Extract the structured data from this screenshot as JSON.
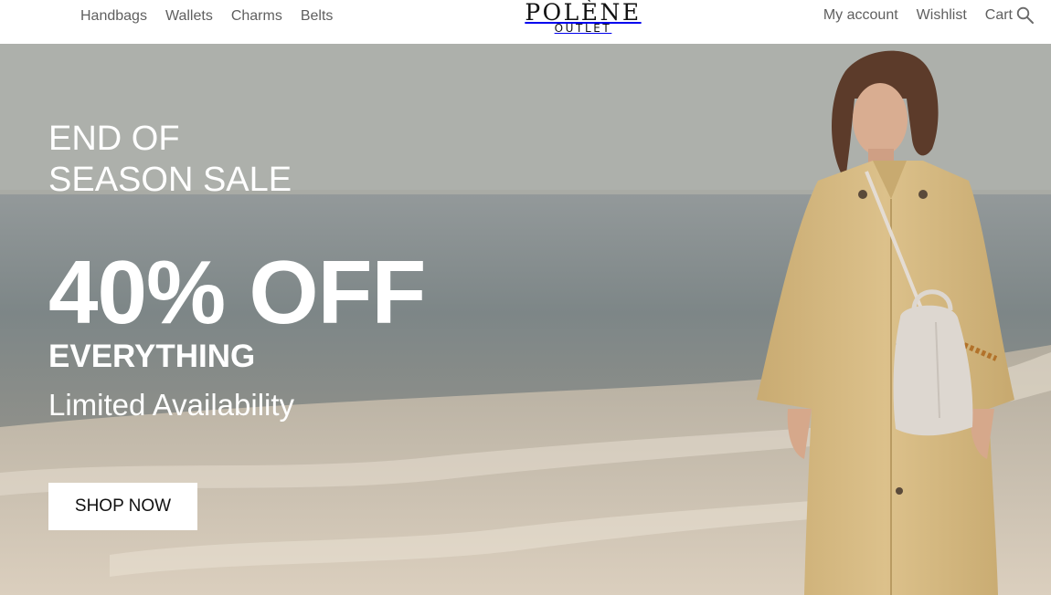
{
  "header": {
    "nav_left": [
      "Handbags",
      "Wallets",
      "Charms",
      "Belts"
    ],
    "logo": {
      "word": "POLÈNE",
      "sub": "OUTLET"
    },
    "nav_right": {
      "account": "My account",
      "wishlist": "Wishlist",
      "cart": "Cart"
    },
    "icons": {
      "search": "search-icon"
    }
  },
  "hero": {
    "headline_line1": "END OF",
    "headline_line2": "SEASON SALE",
    "discount": "40% OFF",
    "subheadline": "EVERYTHING",
    "availability": "Limited Availability",
    "cta_label": "SHOP NOW"
  },
  "colors": {
    "header_bg": "#ffffff",
    "nav_text": "#5f5f5f",
    "hero_text": "#ffffff",
    "cta_bg": "#ffffff",
    "cta_text": "#111111",
    "coat": "#d8bd85",
    "bag": "#ddd7d0"
  }
}
